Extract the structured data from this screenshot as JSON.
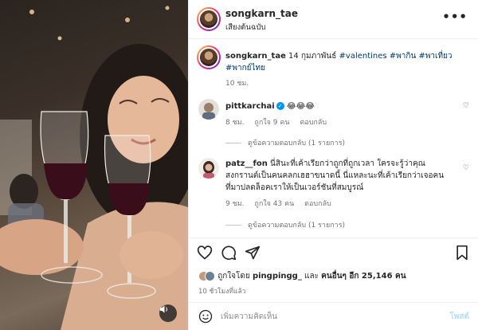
{
  "post": {
    "username": "songkarn_tae",
    "audio_label": "เสียงต้นฉบับ",
    "more_icon": "more-horizontal-icon"
  },
  "caption": {
    "username": "songkarn_tae",
    "text": "14 กุมภาพันธ์",
    "hashtags": "#valentines #พากิน #พาเที่ยว #พากย์ไทย",
    "time": "10 ชม."
  },
  "comments": [
    {
      "username": "pittkarchai",
      "verified": true,
      "text": "😂😂😂",
      "time": "8 ชม.",
      "likes": "ถูกใจ 9 คน",
      "reply_label": "ตอบกลับ",
      "view_replies": "ดูข้อความตอบกลับ (1 รายการ)"
    },
    {
      "username": "patz__fon",
      "verified": false,
      "text": "นี่สินะที่เค้าเรียกว่าถูกที่ถูกเวลา ใครจะรู้ว่าคุณสงกรานต์เป็นคนคลกเฮฮาขนาดนี้ นี่แหละนะที่เค้าเรียกว่าเจอคนที่มาปลดล็อคเราให้เป็นเวอร์ชันที่สมบูรณ์",
      "time": "9 ชม.",
      "likes": "ถูกใจ 43 คน",
      "reply_label": "ตอบกลับ",
      "view_replies": "ดูข้อความตอบกลับ (1 รายการ)"
    }
  ],
  "likes": {
    "prefix": "ถูกใจโดย",
    "user": "pingpingg_",
    "connector": "และ",
    "others": "คนอื่นๆ อีก 25,146 คน"
  },
  "time_ago": "10 ชั่วโมงที่แล้ว",
  "comment_box": {
    "placeholder": "เพิ่มความคิดเห็น",
    "post_label": "โพสต์"
  },
  "colors": {
    "link": "#00376b",
    "verified": "#0095f6",
    "post_disabled": "#b2dffc"
  }
}
